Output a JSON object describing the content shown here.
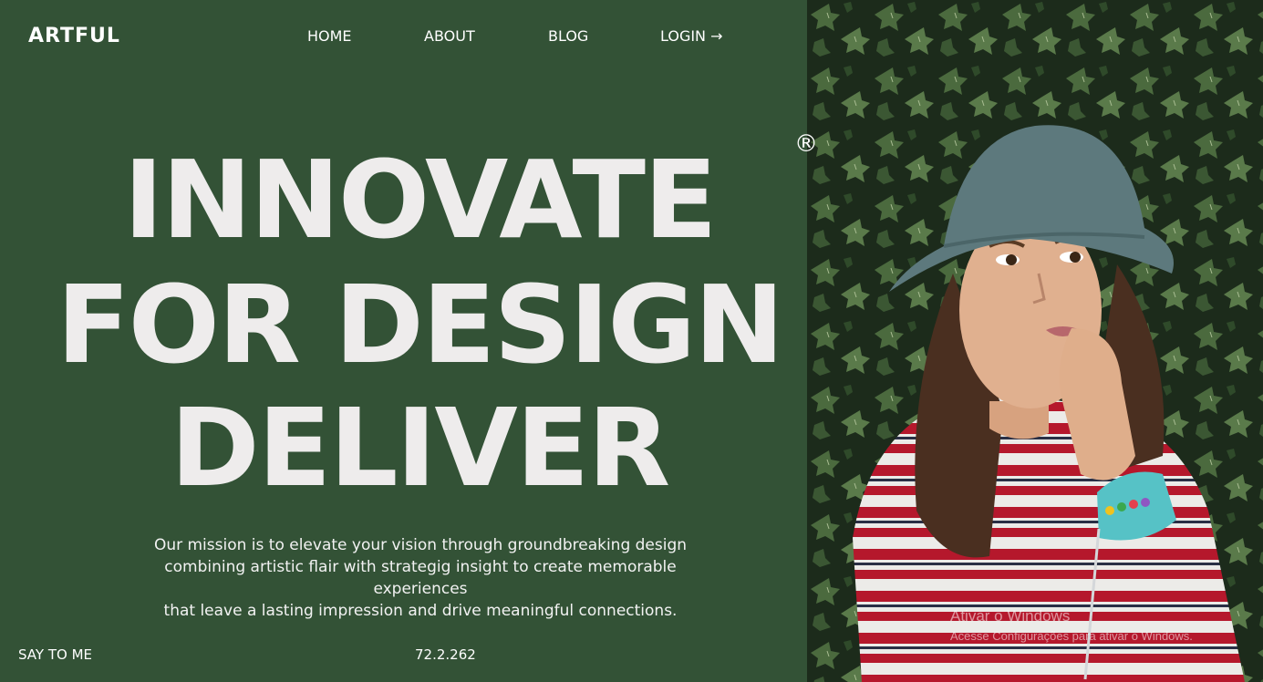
{
  "brand": {
    "logo": "ARTFUL"
  },
  "nav": {
    "home": "HOME",
    "about": "ABOUT",
    "blog": "BLOG",
    "login": "LOGIN →"
  },
  "hero": {
    "line1": "INNOVATE",
    "line2": "FOR DESIGN",
    "line3": "DELIVER",
    "registered_mark": "®"
  },
  "mission": {
    "line1": "Our mission is to elevate your vision through groundbreaking design",
    "line2": "combining artistic flair with strategig insight to create memorable experiences",
    "line3": "that leave a lasting impression and drive meaningful connections."
  },
  "footer": {
    "say": "SAY TO ME",
    "number": "72.2.262"
  },
  "watermark": {
    "title": "Ativar o Windows",
    "subtitle": "Acesse Configurações para ativar o Windows."
  },
  "colors": {
    "panel": "#335236",
    "text": "#eeecec"
  }
}
